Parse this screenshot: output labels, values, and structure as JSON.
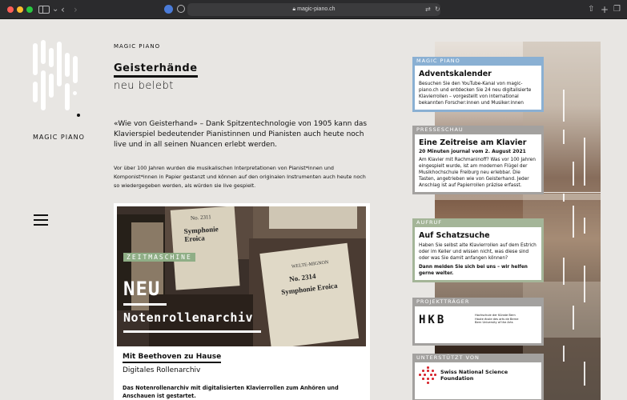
{
  "browser": {
    "url": "magic-piano.ch",
    "icons": {
      "back": "chevron-left-icon",
      "forward": "chevron-right-icon",
      "share": "share-icon",
      "new_tab": "plus-icon",
      "tabs": "tabs-icon",
      "translate": "translate-icon"
    }
  },
  "logo": {
    "text": "MAGIC PIANO"
  },
  "header": {
    "site_label": "MAGIC PIANO",
    "headline": "Geisterhände",
    "subheadline": "neu belebt"
  },
  "intro": {
    "lead": "«Wie von Geisterhand» – Dank Spitzentechnologie von 1905 kann das Klavierspiel bedeutender Pianistinnen und Pianisten auch heute noch live und in all seinen Nuancen erlebt werden.",
    "body": "Vor über 100 Jahren wurden die musikalischen Interpretationen von Pianist*innen und Komponist*innen in Papier gestanzt und können auf den originalen Instrumenten auch heute noch so wiedergegeben werden, als würden sie live gespielt."
  },
  "feature": {
    "tag": "ZEITMASCHINE",
    "big": "NEU",
    "sub": "Notenrollenarchiv",
    "image_labels": [
      "No. 2311",
      "Symphonie Eroica",
      "No. 2314",
      "Symphonie Eroica",
      "WELTE-MIGNON"
    ],
    "title": "Mit Beethoven zu Hause",
    "subtitle": "Digitales Rollenarchiv",
    "text": "Das Notenrollenarchiv mit digitalisierten Klavierrollen zum Anhören und Anschauen ist gestartet."
  },
  "sidebar": {
    "cards": [
      {
        "head": "MAGIC PIANO",
        "title": "Adventskalender",
        "text": "Besuchen Sie den YouTube-Kanal von magic-piano.ch und entdecken Sie 24 neu digitalisierte Klavierrollen – vorgestellt von international bekannten Forscher:innen und Musiker:innen"
      },
      {
        "head": "PRESSESCHAU",
        "title": "Eine Zeitreise am Klavier",
        "sub": "20 Minuten journal vom 2. August 2021",
        "text": "Am Klavier mit Rachmaninoff? Was vor 100 Jahren eingespielt wurde, ist am modernen Flügel der Musikhochschule Freiburg neu erlebbar. Die Tasten, angetrieben wie von Geisterhand. Jeder Anschlag ist auf Papierrollen präzise erfasst."
      },
      {
        "head": "AUFRUF",
        "title": "Auf Schatzsuche",
        "text": "Haben Sie selbst alte Klavierrollen auf dem Estrich oder im Keller und wissen nicht, was diese sind oder was Sie damit anfangen können?",
        "cta": "Dann melden Sie sich bei uns – wir helfen gerne weiter."
      },
      {
        "head": "PROJEKTTRÄGER",
        "logo": "HKB",
        "logo_small": "Hochschule der Künste Bern\nHaute école des arts de Berne\nBern University of the Arts"
      },
      {
        "head": "UNTERSTÜTZT VON",
        "logo": "Swiss National Science Foundation"
      }
    ]
  },
  "colors": {
    "background": "#e8e6e3",
    "blue_head": "#8ab0d3",
    "grey_head": "#a3a19f",
    "green_head": "#a4b598",
    "tag_green": "#8fae86"
  }
}
